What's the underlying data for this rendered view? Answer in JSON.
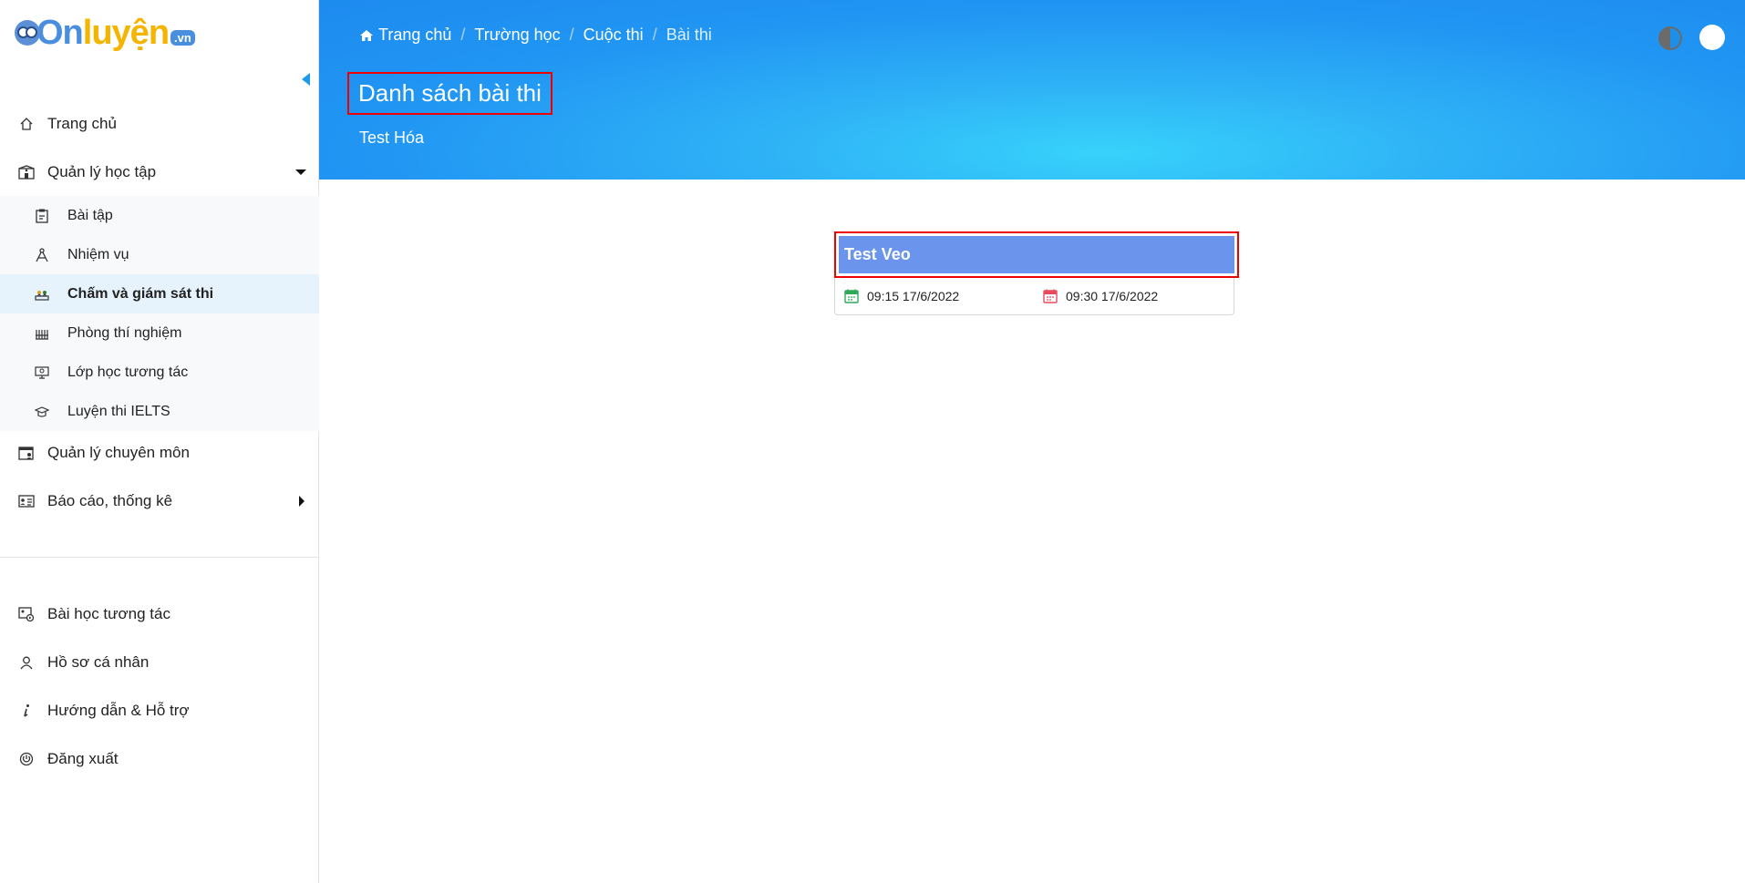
{
  "logo": {
    "on": "On",
    "luyen": "luyện",
    "vn": ".vn"
  },
  "sidebar": {
    "items": [
      {
        "label": "Trang chủ"
      },
      {
        "label": "Quản lý học tập"
      },
      {
        "label": "Quản lý chuyên môn"
      },
      {
        "label": "Báo cáo, thống kê"
      }
    ],
    "submenu": [
      {
        "label": "Bài tập"
      },
      {
        "label": "Nhiệm vụ"
      },
      {
        "label": "Chấm và giám sát thi"
      },
      {
        "label": "Phòng thí nghiệm"
      },
      {
        "label": "Lớp học tương tác"
      },
      {
        "label": "Luyện thi IELTS"
      }
    ],
    "bottom_items": [
      {
        "label": "Bài học tương tác"
      },
      {
        "label": "Hồ sơ cá nhân"
      },
      {
        "label": "Hướng dẫn & Hỗ trợ"
      },
      {
        "label": "Đăng xuất"
      }
    ]
  },
  "header": {
    "breadcrumb": [
      "Trang chủ",
      "Trường học",
      "Cuộc thi",
      "Bài thi"
    ],
    "title": "Danh sách bài thi",
    "subtitle": "Test Hóa"
  },
  "exam_card": {
    "name": "Test Veo",
    "start_time": "09:15 17/6/2022",
    "end_time": "09:30 17/6/2022",
    "start_color": "#2eaa5a",
    "end_color": "#e84a5f"
  },
  "colors": {
    "accent": "#2196f3",
    "card_header": "#6b95ec",
    "highlight": "#e00000"
  }
}
